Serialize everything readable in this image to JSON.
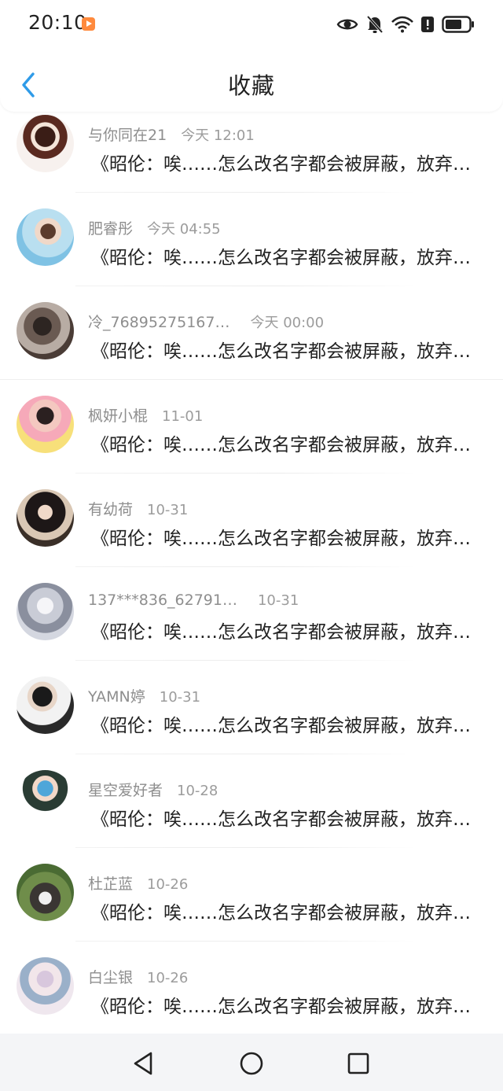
{
  "status_bar": {
    "time": "20:10",
    "icons": [
      "app-notification-icon",
      "eye-icon",
      "mute-bell-icon",
      "wifi-icon",
      "alert-icon",
      "battery-icon"
    ]
  },
  "header": {
    "title": "收藏",
    "back_icon": "chevron-left-icon",
    "accent_color": "#2f9be8"
  },
  "items": [
    {
      "name": "与你同在21",
      "date": "今天 12:01",
      "content": "《昭伦：唉……怎么改名字都会被屏蔽，放弃了》"
    },
    {
      "name": "肥睿彤",
      "date": "今天 04:55",
      "content": "《昭伦：唉……怎么改名字都会被屏蔽，放弃了》"
    },
    {
      "name": "冷_76895275167…",
      "date": "今天 00:00",
      "content": "《昭伦：唉……怎么改名字都会被屏蔽，放弃了》"
    },
    {
      "name": "枫妍小棍",
      "date": "11-01",
      "content": "《昭伦：唉……怎么改名字都会被屏蔽，放弃了》"
    },
    {
      "name": "有幼荷",
      "date": "10-31",
      "content": "《昭伦：唉……怎么改名字都会被屏蔽，放弃了》"
    },
    {
      "name": "137***836_62791…",
      "date": "10-31",
      "content": "《昭伦：唉……怎么改名字都会被屏蔽，放弃了》"
    },
    {
      "name": "YAMN婷",
      "date": "10-31",
      "content": "《昭伦：唉……怎么改名字都会被屏蔽，放弃了》"
    },
    {
      "name": "星空爱好者",
      "date": "10-28",
      "content": "《昭伦：唉……怎么改名字都会被屏蔽，放弃了》"
    },
    {
      "name": "杜芷蓝",
      "date": "10-26",
      "content": "《昭伦：唉……怎么改名字都会被屏蔽，放弃了》"
    },
    {
      "name": "白尘银",
      "date": "10-26",
      "content": "《昭伦：唉……怎么改名字都会被屏蔽，放弃了》"
    }
  ],
  "nav_bar": {
    "icons": [
      "back-triangle-icon",
      "home-circle-icon",
      "recents-square-icon"
    ]
  }
}
